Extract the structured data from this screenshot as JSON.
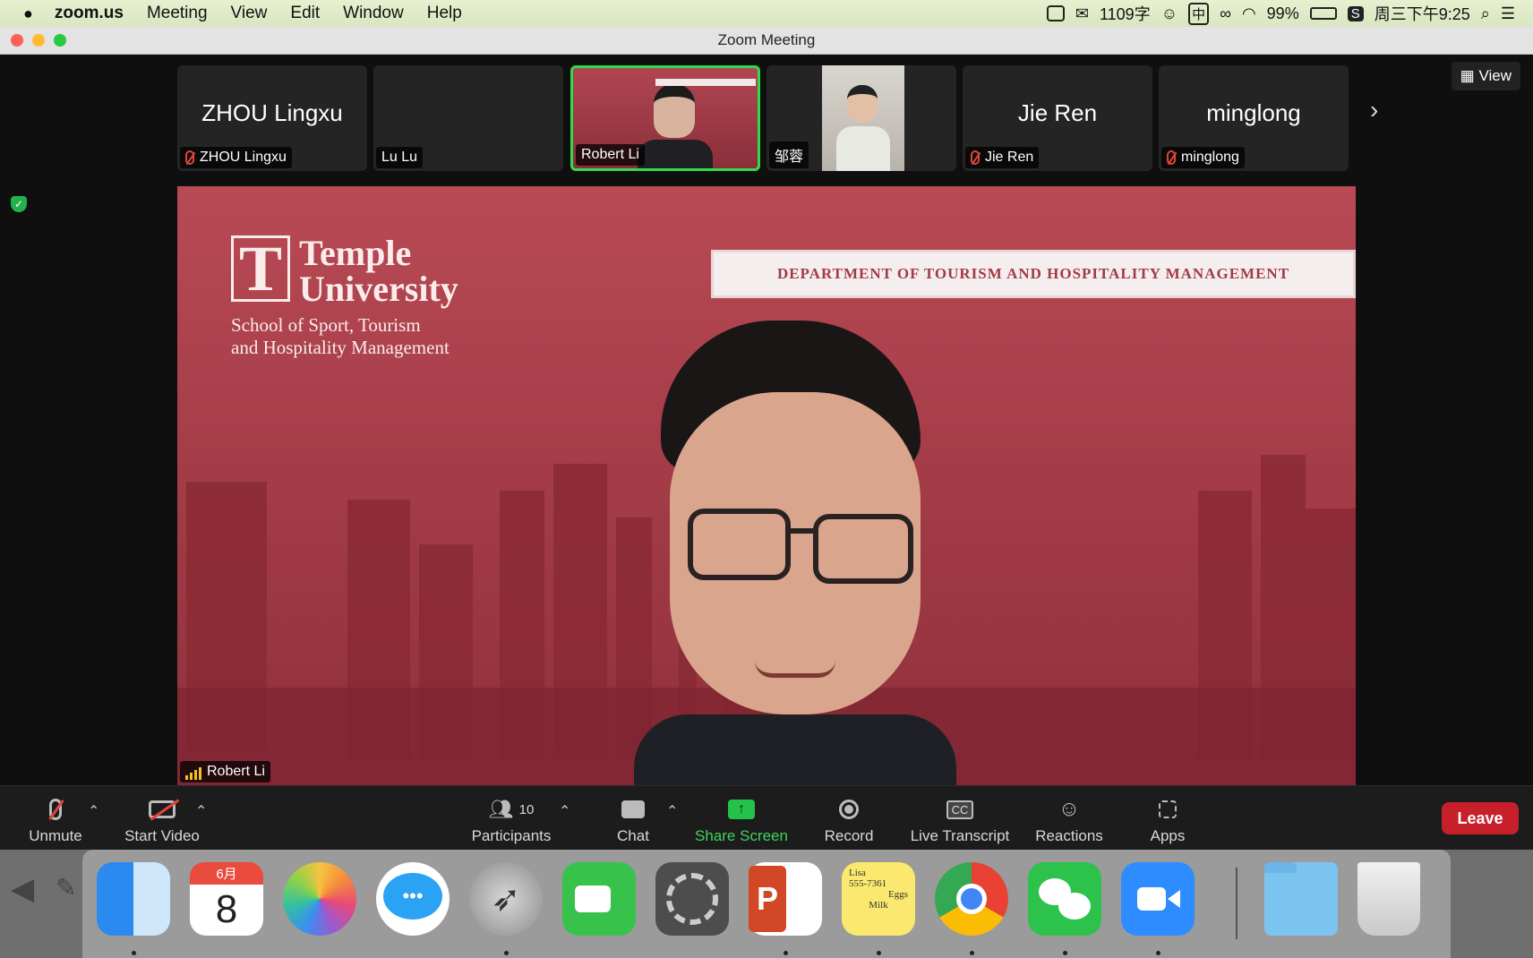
{
  "menubar": {
    "app_name": "zoom.us",
    "items": [
      "Meeting",
      "View",
      "Edit",
      "Window",
      "Help"
    ],
    "word_count": "1109字",
    "input_method": "中",
    "battery": "99%",
    "clock": "周三下午9:25"
  },
  "window": {
    "title": "Zoom Meeting"
  },
  "view_button": "View",
  "participants_strip": [
    {
      "display": "ZHOU Lingxu",
      "name": "ZHOU Lingxu",
      "muted": true
    },
    {
      "display": "",
      "name": "Lu Lu",
      "muted": false
    },
    {
      "display": "",
      "name": "Robert Li",
      "muted": false,
      "active": true
    },
    {
      "display": "",
      "name": "邹蓉",
      "muted": false
    },
    {
      "display": "Jie Ren",
      "name": "Jie Ren",
      "muted": true
    },
    {
      "display": "minglong",
      "name": "minglong",
      "muted": true
    }
  ],
  "main_video": {
    "speaker": "Robert Li",
    "logo_line1": "Temple",
    "logo_line2": "University",
    "logo_sub1": "School of Sport, Tourism",
    "logo_sub2": "and Hospitality Management",
    "banner": "DEPARTMENT OF TOURISM AND HOSPITALITY MANAGEMENT"
  },
  "toolbar": {
    "unmute": "Unmute",
    "start_video": "Start Video",
    "participants": "Participants",
    "participants_count": "10",
    "chat": "Chat",
    "share_screen": "Share Screen",
    "record": "Record",
    "live_transcript": "Live Transcript",
    "cc": "CC",
    "reactions": "Reactions",
    "apps": "Apps",
    "leave": "Leave"
  },
  "dock": {
    "calendar_month": "6月",
    "calendar_day": "8",
    "note_line1": "Lisa",
    "note_line2": "555-7361",
    "note_line3": "Eggs",
    "note_line4": "Milk",
    "icons": [
      "finder-icon",
      "calendar-icon",
      "photos-icon",
      "messages-icon",
      "launchpad-icon",
      "facetime-icon",
      "system-preferences-icon",
      "powerpoint-icon",
      "stickies-icon",
      "chrome-icon",
      "wechat-icon",
      "zoom-icon",
      "downloads-folder-icon",
      "trash-icon"
    ]
  }
}
